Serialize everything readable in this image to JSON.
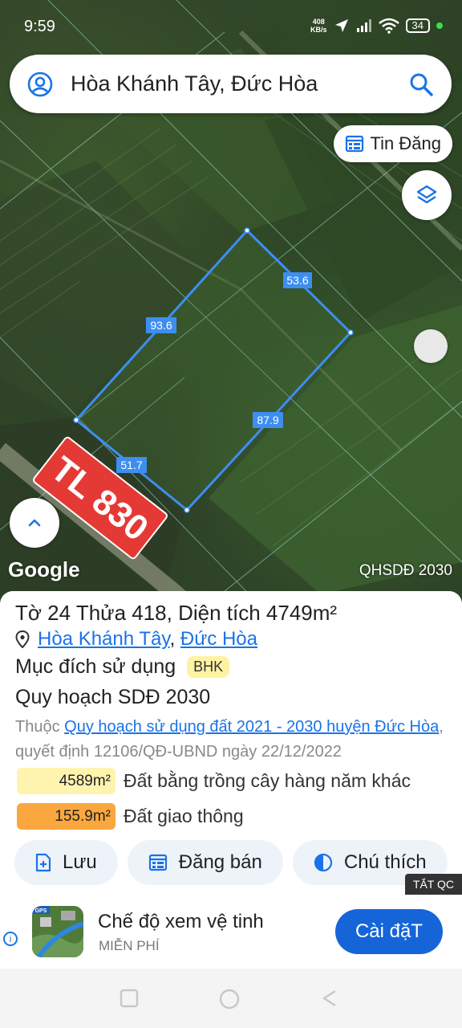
{
  "status_bar": {
    "time": "9:59",
    "net_speed_value": "408",
    "net_speed_unit": "KB/s",
    "battery": "34"
  },
  "search": {
    "value": "Hòa Khánh Tây, Đức Hòa"
  },
  "map": {
    "tin_dang_label": "Tin Đăng",
    "road_label": "TL 830",
    "edge_labels": [
      "53.6",
      "93.6",
      "87.9",
      "51.7"
    ],
    "google_label": "Google",
    "overlay_label": "QHSDĐ 2030"
  },
  "panel": {
    "title": "Tờ 24 Thửa 418, Diện tích 4749m²",
    "location_commune": "Hòa Khánh Tây",
    "location_separator": ",",
    "location_district": "Đức Hòa",
    "purpose_label": "Mục đích sử dụng",
    "purpose_code": "BHK",
    "plan_label": "Quy hoạch SDĐ 2030",
    "note_prefix": "Thuộc",
    "note_link": "Quy hoạch sử dụng đất 2021 - 2030 huyện Đức Hòa",
    "note_suffix": ", quyết định 12106/QĐ-UBND ngày 22/12/2022",
    "land_uses": [
      {
        "area": "4589m²",
        "label": "Đất bằng trồng cây hàng năm khác",
        "color": "#fff3b0"
      },
      {
        "area": "155.9m²",
        "label": "Đất giao thông",
        "color": "#f9a73e"
      }
    ],
    "actions": {
      "save": "Lưu",
      "post_sale": "Đăng bán",
      "legend": "Chú thích"
    }
  },
  "ad": {
    "close_label": "TẮT QC",
    "title": "Chế độ xem vệ tinh",
    "subtitle": "MIỄN PHÍ",
    "install_label": "Cài đặT",
    "icon_badge": "GPS"
  },
  "colors": {
    "accent": "#1a73e8",
    "parcel_outline": "#3d8ef0",
    "road_label_bg": "#e53935",
    "install_button": "#1565d8"
  }
}
